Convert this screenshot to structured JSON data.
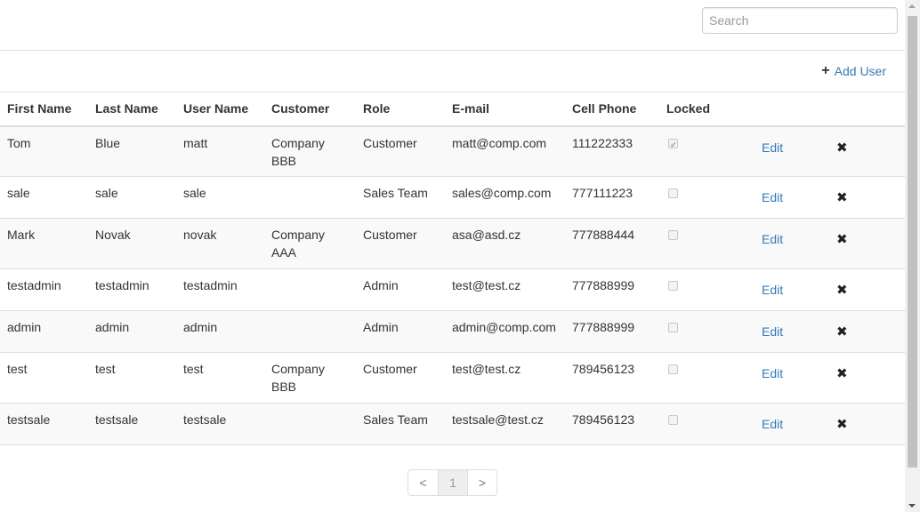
{
  "search": {
    "placeholder": "Search",
    "value": ""
  },
  "toolbar": {
    "add_user_label": "Add User"
  },
  "table": {
    "headers": [
      "First Name",
      "Last Name",
      "User Name",
      "Customer",
      "Role",
      "E-mail",
      "Cell Phone",
      "Locked"
    ],
    "rows": [
      {
        "first": "Tom",
        "last": "Blue",
        "user": "matt",
        "customer": "Company BBB",
        "role": "Customer",
        "email": "matt@comp.com",
        "phone": "111222333",
        "locked": true,
        "edit": "Edit"
      },
      {
        "first": "sale",
        "last": "sale",
        "user": "sale",
        "customer": "",
        "role": "Sales Team",
        "email": "sales@comp.com",
        "phone": "777111223",
        "locked": false,
        "edit": "Edit"
      },
      {
        "first": "Mark",
        "last": "Novak",
        "user": "novak",
        "customer": "Company AAA",
        "role": "Customer",
        "email": "asa@asd.cz",
        "phone": "777888444",
        "locked": false,
        "edit": "Edit"
      },
      {
        "first": "testadmin",
        "last": "testadmin",
        "user": "testadmin",
        "customer": "",
        "role": "Admin",
        "email": "test@test.cz",
        "phone": "777888999",
        "locked": false,
        "edit": "Edit"
      },
      {
        "first": "admin",
        "last": "admin",
        "user": "admin",
        "customer": "",
        "role": "Admin",
        "email": "admin@comp.com",
        "phone": "777888999",
        "locked": false,
        "edit": "Edit"
      },
      {
        "first": "test",
        "last": "test",
        "user": "test",
        "customer": "Company BBB",
        "role": "Customer",
        "email": "test@test.cz",
        "phone": "789456123",
        "locked": false,
        "edit": "Edit"
      },
      {
        "first": "testsale",
        "last": "testsale",
        "user": "testsale",
        "customer": "",
        "role": "Sales Team",
        "email": "testsale@test.cz",
        "phone": "789456123",
        "locked": false,
        "edit": "Edit"
      }
    ]
  },
  "pagination": {
    "prev": "<",
    "current": "1",
    "next": ">"
  },
  "colors": {
    "link": "#337ab7",
    "border": "#dddddd",
    "stripe": "#f9f9f9"
  },
  "icons": {
    "add": "plus-icon",
    "delete": "times-icon"
  }
}
